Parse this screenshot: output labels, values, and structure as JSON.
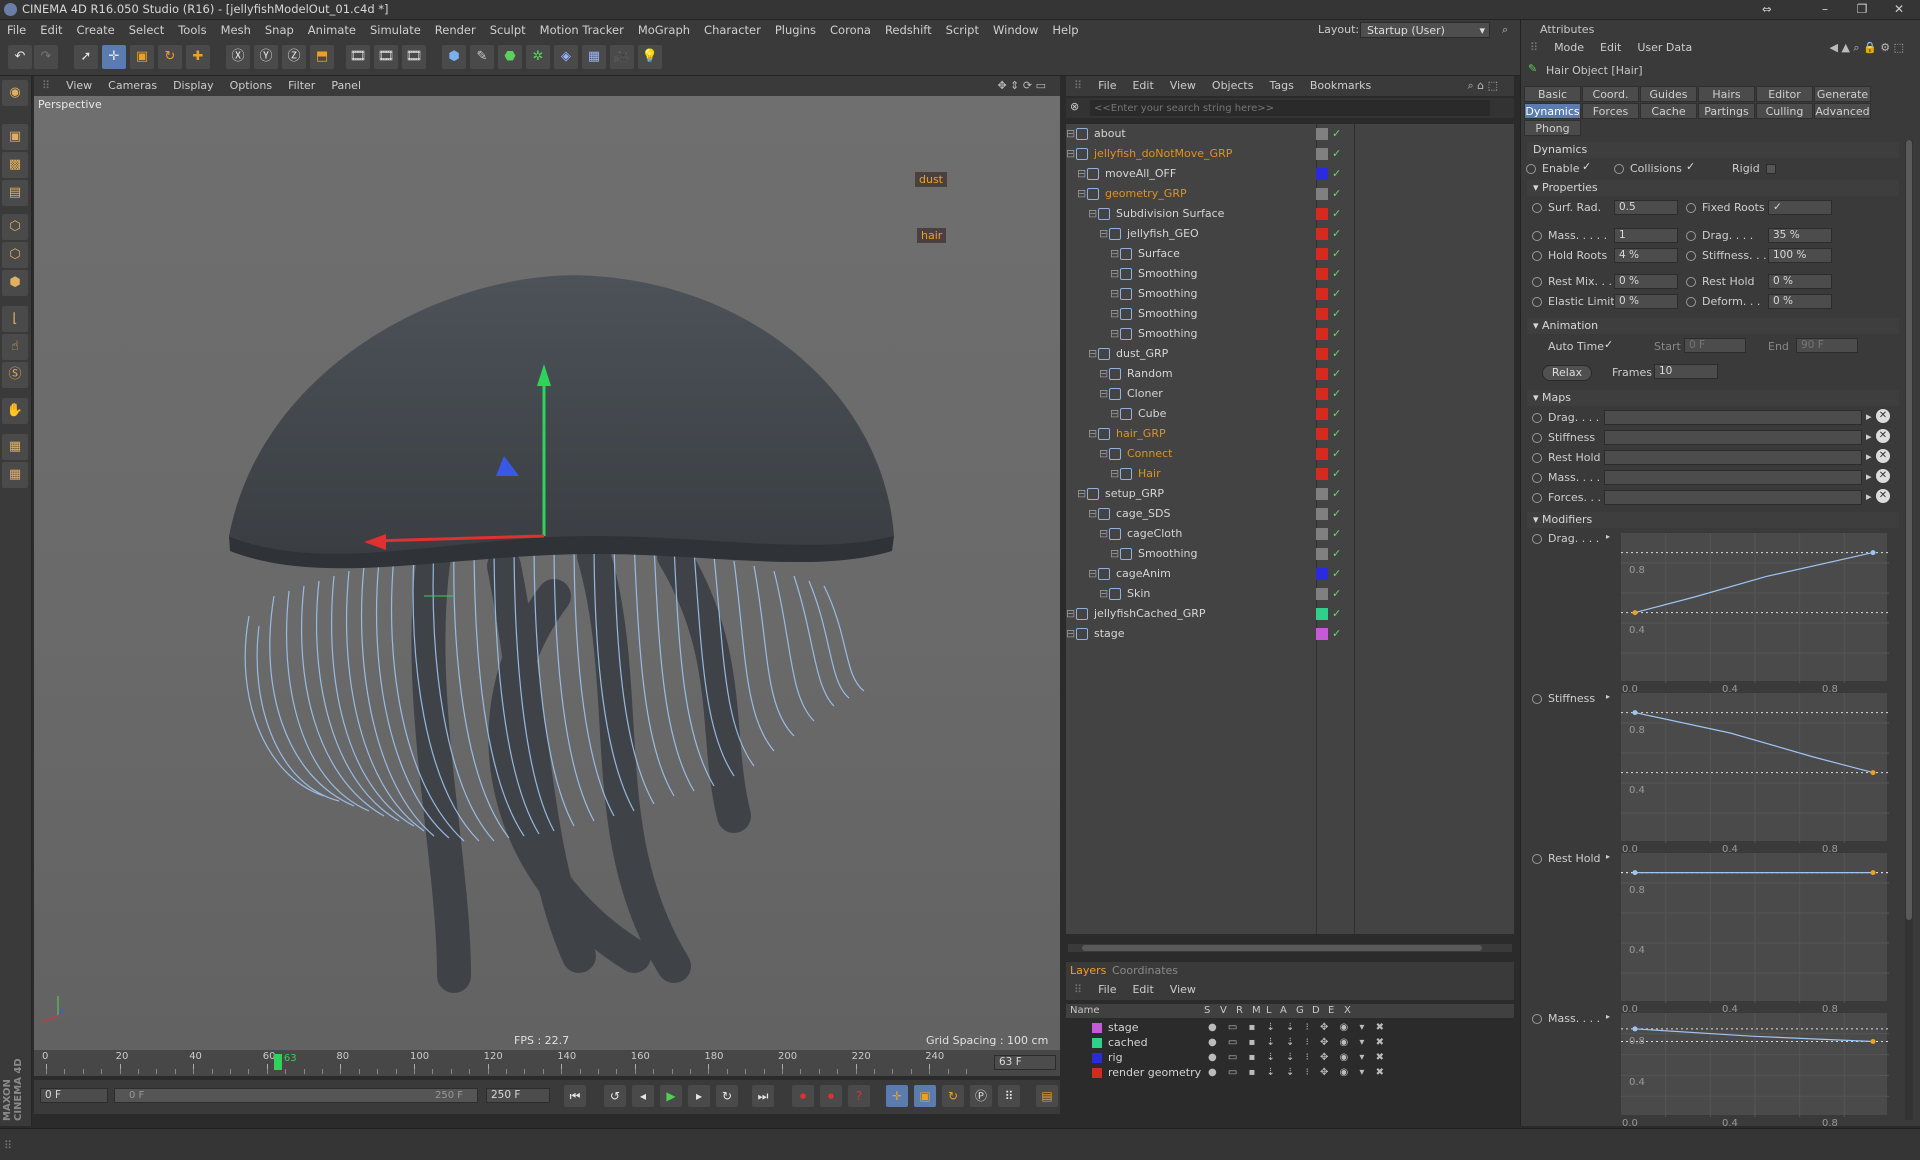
{
  "window": {
    "title": "CINEMA 4D R16.050 Studio (R16) - [jellyfishModelOut_01.c4d *]",
    "layout_label": "Layout:",
    "layout_value": "Startup (User)",
    "minimize": "–",
    "maximize": "❐",
    "close": "✕"
  },
  "menubar": [
    "File",
    "Edit",
    "Create",
    "Select",
    "Tools",
    "Mesh",
    "Snap",
    "Animate",
    "Simulate",
    "Render",
    "Sculpt",
    "Motion Tracker",
    "MoGraph",
    "Character",
    "Plugins",
    "Corona",
    "Redshift",
    "Script",
    "Window",
    "Help"
  ],
  "viewport": {
    "menu": [
      "View",
      "Cameras",
      "Display",
      "Options",
      "Filter",
      "Panel"
    ],
    "name": "Perspective",
    "fps": "FPS : 22.7",
    "grid_spacing": "Grid Spacing : 100 cm",
    "tag_dust": "dust",
    "tag_hair": "hair"
  },
  "object_manager": {
    "menu": [
      "File",
      "Edit",
      "View",
      "Objects",
      "Tags",
      "Bookmarks"
    ],
    "search_placeholder": "<<Enter your search string here>>",
    "rows": [
      {
        "name": "about",
        "indent": 0,
        "color": "#808080",
        "orange": false
      },
      {
        "name": "jellyfish_doNotMove_GRP",
        "indent": 0,
        "color": "#808080",
        "orange": true
      },
      {
        "name": "moveAll_OFF",
        "indent": 1,
        "color": "#2a2adf",
        "orange": false
      },
      {
        "name": "geometry_GRP",
        "indent": 1,
        "color": "#808080",
        "orange": true
      },
      {
        "name": "Subdivision Surface",
        "indent": 2,
        "color": "#d42a1f",
        "orange": false
      },
      {
        "name": "jellyfish_GEO",
        "indent": 3,
        "color": "#d42a1f",
        "orange": false
      },
      {
        "name": "Surface",
        "indent": 4,
        "color": "#d42a1f",
        "orange": false
      },
      {
        "name": "Smoothing",
        "indent": 4,
        "color": "#d42a1f",
        "orange": false
      },
      {
        "name": "Smoothing",
        "indent": 4,
        "color": "#d42a1f",
        "orange": false
      },
      {
        "name": "Smoothing",
        "indent": 4,
        "color": "#d42a1f",
        "orange": false
      },
      {
        "name": "Smoothing",
        "indent": 4,
        "color": "#d42a1f",
        "orange": false
      },
      {
        "name": "dust_GRP",
        "indent": 2,
        "color": "#d42a1f",
        "orange": false
      },
      {
        "name": "Random",
        "indent": 3,
        "color": "#d42a1f",
        "orange": false
      },
      {
        "name": "Cloner",
        "indent": 3,
        "color": "#d42a1f",
        "orange": false
      },
      {
        "name": "Cube",
        "indent": 4,
        "color": "#d42a1f",
        "orange": false
      },
      {
        "name": "hair_GRP",
        "indent": 2,
        "color": "#d42a1f",
        "orange": true
      },
      {
        "name": "Connect",
        "indent": 3,
        "color": "#d42a1f",
        "orange": true
      },
      {
        "name": "Hair",
        "indent": 4,
        "color": "#d42a1f",
        "orange": true
      },
      {
        "name": "setup_GRP",
        "indent": 1,
        "color": "#808080",
        "orange": false
      },
      {
        "name": "cage_SDS",
        "indent": 2,
        "color": "#808080",
        "orange": false
      },
      {
        "name": "cageCloth",
        "indent": 3,
        "color": "#808080",
        "orange": false
      },
      {
        "name": "Smoothing",
        "indent": 4,
        "color": "#808080",
        "orange": false
      },
      {
        "name": "cageAnim",
        "indent": 2,
        "color": "#2a2adf",
        "orange": false
      },
      {
        "name": "Skin",
        "indent": 3,
        "color": "#808080",
        "orange": false
      },
      {
        "name": "jellyfishCached_GRP",
        "indent": 0,
        "color": "#2fd08a",
        "orange": false
      },
      {
        "name": "stage",
        "indent": 0,
        "color": "#c45ad8",
        "orange": false
      }
    ]
  },
  "layers": {
    "tabs": [
      "Layers",
      "Coordinates"
    ],
    "menu": [
      "File",
      "Edit",
      "View"
    ],
    "columns": [
      "Name",
      "S",
      "V",
      "R",
      "M",
      "L",
      "A",
      "G",
      "D",
      "E",
      "X"
    ],
    "rows": [
      {
        "name": "stage",
        "color": "#c45ad8"
      },
      {
        "name": "cached",
        "color": "#2fd08a"
      },
      {
        "name": "rig",
        "color": "#2a2adf"
      },
      {
        "name": "render geometry",
        "color": "#d42a1f"
      }
    ]
  },
  "attributes": {
    "title": "Attributes",
    "menu": [
      "Mode",
      "Edit",
      "User Data"
    ],
    "object": "Hair Object [Hair]",
    "tabs_row1": [
      "Basic",
      "Coord.",
      "Guides",
      "Hairs",
      "Editor",
      "Generate"
    ],
    "tabs_row2": [
      "Dynamics",
      "Forces",
      "Cache",
      "Partings",
      "Culling",
      "Advanced"
    ],
    "tabs_row3": [
      "Phong"
    ],
    "active_tab": "Dynamics",
    "section_dynamics": "Dynamics",
    "enable": "Enable",
    "collisions": "Collisions",
    "rigid": "Rigid",
    "section_properties": "Properties",
    "props": [
      {
        "label": "Surf. Rad.",
        "value": "0.5",
        "label2": "Fixed Roots",
        "value2": "✓"
      },
      {
        "label": "Mass. . . . .",
        "value": "1",
        "label2": "Drag. . . .",
        "value2": "35 %"
      },
      {
        "label": "Hold Roots",
        "value": "4 %",
        "label2": "Stiffness. . .",
        "value2": "100 %"
      },
      {
        "label": "Rest Mix. . .",
        "value": "0 %",
        "label2": "Rest Hold",
        "value2": "0 %"
      },
      {
        "label": "Elastic Limit",
        "value": "0 %",
        "label2": "Deform. . .",
        "value2": "0 %"
      }
    ],
    "section_animation": "Animation",
    "auto_time": "Auto Time",
    "start_label": "Start",
    "start_value": "0 F",
    "end_label": "End",
    "end_value": "90 F",
    "relax": "Relax",
    "frames_label": "Frames",
    "frames_value": "10",
    "section_maps": "Maps",
    "maps": [
      "Drag. . . .",
      "Stiffness",
      "Rest Hold",
      "Mass. . . .",
      "Forces. . ."
    ],
    "section_modifiers": "Modifiers",
    "modifiers": [
      "Drag. . . .",
      "Stiffness",
      "Rest Hold",
      "Mass. . . ."
    ],
    "curve_ticks_x": [
      "0.0",
      "0.4",
      "0.8"
    ],
    "curve_ticks_y": [
      "0.8",
      "0.4"
    ]
  },
  "timeline": {
    "ticks": [
      "0",
      "20",
      "40",
      "60",
      "80",
      "100",
      "120",
      "140",
      "160",
      "180",
      "200",
      "220",
      "240"
    ],
    "current_frame": "63",
    "current_frame_field": "63 F",
    "start_field": "0 F",
    "range_start": "0 F",
    "range_end": "250 F",
    "end_field": "250 F"
  }
}
